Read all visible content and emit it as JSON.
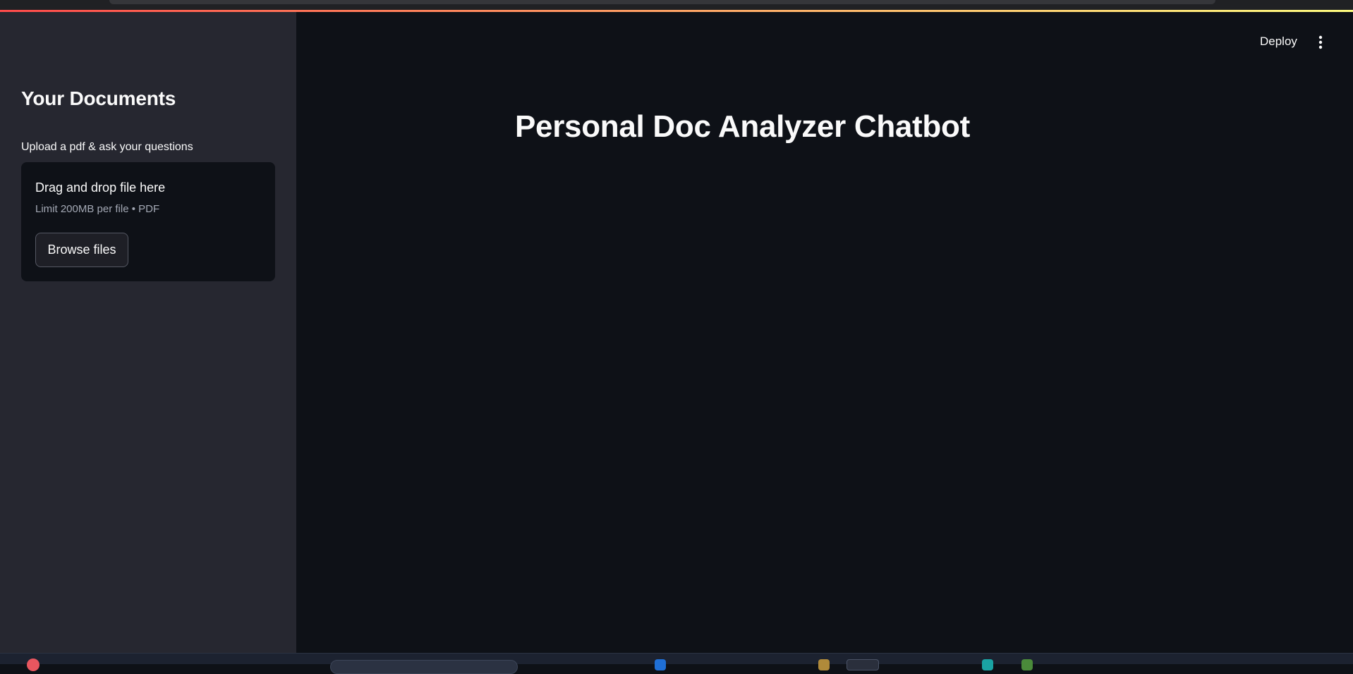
{
  "sidebar": {
    "title": "Your Documents",
    "caption": "Upload a pdf & ask your questions",
    "uploader": {
      "drop_text": "Drag and drop file here",
      "limit_text": "Limit 200MB per file • PDF",
      "browse_label": "Browse files"
    }
  },
  "header": {
    "deploy_label": "Deploy",
    "menu_icon": "vertical-ellipsis-icon"
  },
  "main": {
    "title": "Personal Doc Analyzer Chatbot"
  },
  "colors": {
    "sidebar_bg": "#262730",
    "main_bg": "#0e1117",
    "accent_gradient_start": "#ff4b4b",
    "accent_gradient_end": "#fffd80"
  }
}
